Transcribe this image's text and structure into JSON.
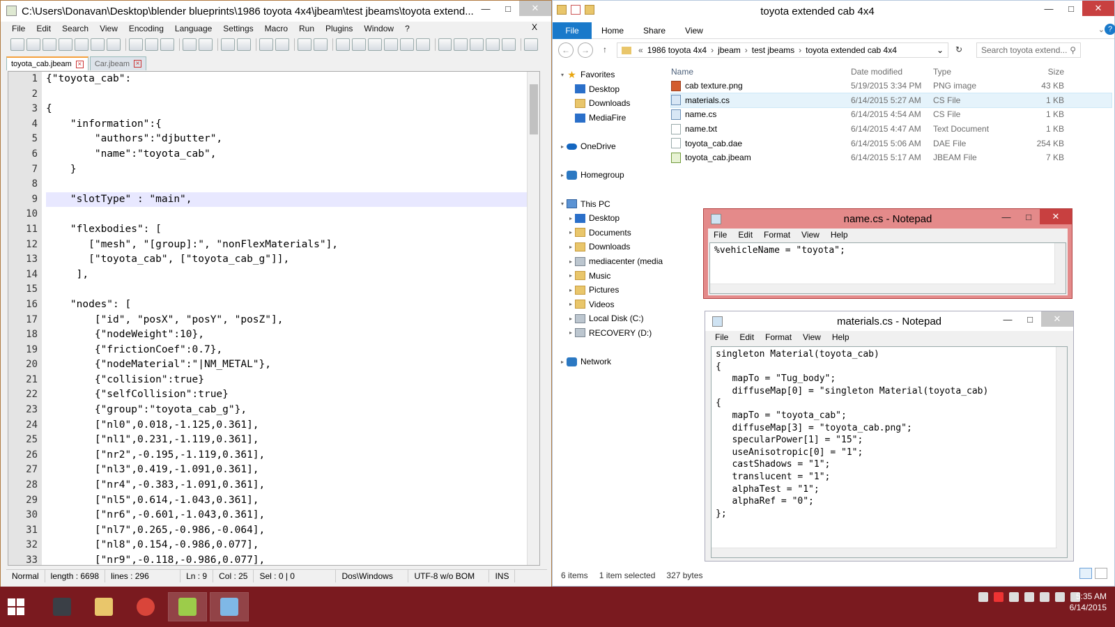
{
  "npp": {
    "title": "C:\\Users\\Donavan\\Desktop\\blender blueprints\\1986 toyota 4x4\\jbeam\\test jbeams\\toyota extend...",
    "menu": [
      "File",
      "Edit",
      "Search",
      "View",
      "Encoding",
      "Language",
      "Settings",
      "Macro",
      "Run",
      "Plugins",
      "Window",
      "?"
    ],
    "menu_close": "X",
    "tabs": [
      {
        "label": "toyota_cab.jbeam"
      },
      {
        "label": "Car.jbeam"
      }
    ],
    "line_numbers": [
      "1",
      "2",
      "3",
      "4",
      "5",
      "6",
      "7",
      "8",
      "9",
      "10",
      "11",
      "12",
      "13",
      "14",
      "15",
      "16",
      "17",
      "18",
      "19",
      "20",
      "21",
      "22",
      "23",
      "24",
      "25",
      "26",
      "27",
      "28",
      "29",
      "30",
      "31",
      "32",
      "33"
    ],
    "code_lines": [
      "{\"toyota_cab\":",
      "",
      "{",
      "    \"information\":{",
      "        \"authors\":\"djbutter\",",
      "        \"name\":\"toyota_cab\",",
      "    }",
      "",
      "    \"slotType\" : \"main\",",
      "",
      "    \"flexbodies\": [",
      "       [\"mesh\", \"[group]:\", \"nonFlexMaterials\"],",
      "       [\"toyota_cab\", [\"toyota_cab_g\"]],",
      "     ],",
      "",
      "    \"nodes\": [",
      "        [\"id\", \"posX\", \"posY\", \"posZ\"],",
      "        {\"nodeWeight\":10},",
      "        {\"frictionCoef\":0.7},",
      "        {\"nodeMaterial\":\"|NM_METAL\"},",
      "        {\"collision\":true}",
      "        {\"selfCollision\":true}",
      "        {\"group\":\"toyota_cab_g\"},",
      "        [\"nl0\",0.018,-1.125,0.361],",
      "        [\"nl1\",0.231,-1.119,0.361],",
      "        [\"nr2\",-0.195,-1.119,0.361],",
      "        [\"nl3\",0.419,-1.091,0.361],",
      "        [\"nr4\",-0.383,-1.091,0.361],",
      "        [\"nl5\",0.614,-1.043,0.361],",
      "        [\"nr6\",-0.601,-1.043,0.361],",
      "        [\"nl7\",0.265,-0.986,-0.064],",
      "        [\"nl8\",0.154,-0.986,0.077],",
      "        [\"nr9\",-0.118,-0.986,0.077],"
    ],
    "current_line_index": 8,
    "status": {
      "mode": "Normal",
      "length": "length : 6698",
      "lines": "lines : 296",
      "ln": "Ln : 9",
      "col": "Col : 25",
      "sel": "Sel : 0 | 0",
      "eol": "Dos\\Windows",
      "encoding": "UTF-8 w/o BOM",
      "ins": "INS"
    }
  },
  "explorer": {
    "title": "toyota extended cab 4x4",
    "ribbon": [
      "File",
      "Home",
      "Share",
      "View"
    ],
    "address": [
      "«",
      "1986 toyota 4x4",
      "jbeam",
      "test jbeams",
      "toyota extended cab 4x4"
    ],
    "search_placeholder": "Search toyota extend...",
    "nav": [
      {
        "label": "Favorites",
        "icon": "star-icon",
        "level": 0,
        "arrow": "▾"
      },
      {
        "label": "Desktop",
        "icon": "desktop-icon",
        "level": 1,
        "arrow": ""
      },
      {
        "label": "Downloads",
        "icon": "folder-icon",
        "level": 1,
        "arrow": ""
      },
      {
        "label": "MediaFire",
        "icon": "mediafire-icon",
        "level": 1,
        "arrow": ""
      },
      {
        "label": "",
        "icon": "",
        "level": 0,
        "arrow": ""
      },
      {
        "label": "OneDrive",
        "icon": "onedrive-icon",
        "level": 0,
        "arrow": "▸"
      },
      {
        "label": "",
        "icon": "",
        "level": 0,
        "arrow": ""
      },
      {
        "label": "Homegroup",
        "icon": "homegroup-icon",
        "level": 0,
        "arrow": "▸"
      },
      {
        "label": "",
        "icon": "",
        "level": 0,
        "arrow": ""
      },
      {
        "label": "This PC",
        "icon": "pc-icon",
        "level": 0,
        "arrow": "▾"
      },
      {
        "label": "Desktop",
        "icon": "desktop-icon",
        "level": 1,
        "arrow": "▸"
      },
      {
        "label": "Documents",
        "icon": "folder-icon",
        "level": 1,
        "arrow": "▸"
      },
      {
        "label": "Downloads",
        "icon": "folder-icon",
        "level": 1,
        "arrow": "▸"
      },
      {
        "label": "mediacenter (media",
        "icon": "network-drive-icon",
        "level": 1,
        "arrow": "▸"
      },
      {
        "label": "Music",
        "icon": "folder-icon",
        "level": 1,
        "arrow": "▸"
      },
      {
        "label": "Pictures",
        "icon": "folder-icon",
        "level": 1,
        "arrow": "▸"
      },
      {
        "label": "Videos",
        "icon": "folder-icon",
        "level": 1,
        "arrow": "▸"
      },
      {
        "label": "Local Disk (C:)",
        "icon": "drive-icon",
        "level": 1,
        "arrow": "▸"
      },
      {
        "label": "RECOVERY (D:)",
        "icon": "drive-icon",
        "level": 1,
        "arrow": "▸"
      },
      {
        "label": "",
        "icon": "",
        "level": 0,
        "arrow": ""
      },
      {
        "label": "Network",
        "icon": "network-icon",
        "level": 0,
        "arrow": "▸"
      }
    ],
    "columns": [
      "Name",
      "Date modified",
      "Type",
      "Size"
    ],
    "files": [
      {
        "name": "cab texture.png",
        "date": "5/19/2015 3:34 PM",
        "type": "PNG image",
        "size": "43 KB",
        "icon": "png"
      },
      {
        "name": "materials.cs",
        "date": "6/14/2015 5:27 AM",
        "type": "CS File",
        "size": "1 KB",
        "icon": "cs"
      },
      {
        "name": "name.cs",
        "date": "6/14/2015 4:54 AM",
        "type": "CS File",
        "size": "1 KB",
        "icon": "cs"
      },
      {
        "name": "name.txt",
        "date": "6/14/2015 4:47 AM",
        "type": "Text Document",
        "size": "1 KB",
        "icon": "txt"
      },
      {
        "name": "toyota_cab.dae",
        "date": "6/14/2015 5:06 AM",
        "type": "DAE File",
        "size": "254 KB",
        "icon": "txt"
      },
      {
        "name": "toyota_cab.jbeam",
        "date": "6/14/2015 5:17 AM",
        "type": "JBEAM File",
        "size": "7 KB",
        "icon": "jb"
      }
    ],
    "selected_file_index": 1,
    "status": {
      "items": "6 items",
      "selected": "1 item selected",
      "bytes": "327 bytes"
    }
  },
  "notepad1": {
    "title": "name.cs - Notepad",
    "menu": [
      "File",
      "Edit",
      "Format",
      "View",
      "Help"
    ],
    "text": "%vehicleName = \"toyota\";"
  },
  "notepad2": {
    "title": "materials.cs - Notepad",
    "menu": [
      "File",
      "Edit",
      "Format",
      "View",
      "Help"
    ],
    "text": "singleton Material(toyota_cab)\n{\n   mapTo = \"Tug_body\";\n   diffuseMap[0] = \"singleton Material(toyota_cab)\n{\n   mapTo = \"toyota_cab\";\n   diffuseMap[3] = \"toyota_cab.png\";\n   specularPower[1] = \"15\";\n   useAnisotropic[0] = \"1\";\n   castShadows = \"1\";\n   translucent = \"1\";\n   alphaTest = \"1\";\n   alphaRef = \"0\";\n};"
  },
  "taskbar": {
    "time": "5:35 AM",
    "date": "6/14/2015",
    "apps": [
      {
        "name": "camera-app-icon",
        "color": "#3a3f46",
        "active": false
      },
      {
        "name": "file-explorer-icon",
        "color": "#e9c66b",
        "active": false
      },
      {
        "name": "chrome-icon",
        "color": "#d9453a",
        "active": false
      },
      {
        "name": "notepadpp-icon",
        "color": "#9ccc4a",
        "active": true
      },
      {
        "name": "notepad-icon",
        "color": "#7fb8e6",
        "active": true
      }
    ]
  },
  "colors": {
    "accent": "#1979ca",
    "taskbar": "#7a1a1f",
    "notepad_active": "#c84040"
  }
}
